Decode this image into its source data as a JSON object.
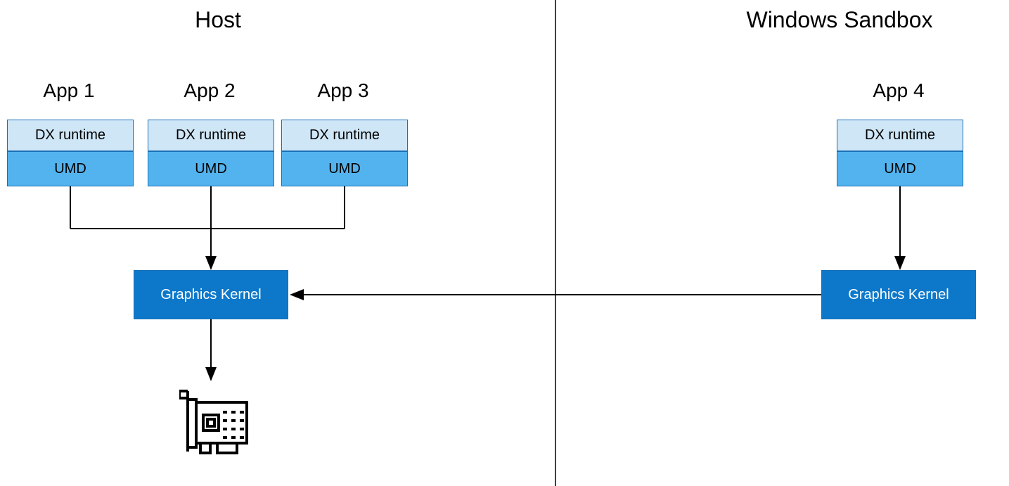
{
  "headings": {
    "host": "Host",
    "sandbox": "Windows Sandbox"
  },
  "apps": {
    "app1": "App 1",
    "app2": "App 2",
    "app3": "App 3",
    "app4": "App 4"
  },
  "labels": {
    "dx_runtime": "DX runtime",
    "umd": "UMD",
    "graphics_kernel": "Graphics Kernel"
  },
  "colors": {
    "dx_bg": "#cfe6f7",
    "umd_bg": "#53b3ee",
    "kernel_bg": "#0d78c9",
    "border": "#1a6fb5"
  }
}
